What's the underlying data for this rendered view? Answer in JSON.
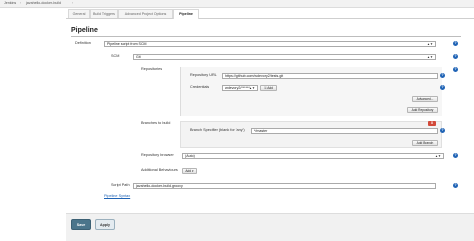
{
  "breadcrumb": {
    "items": [
      "Jenkins",
      "javahello-docker-build"
    ],
    "separator": "›"
  },
  "tabs": [
    {
      "label": "General"
    },
    {
      "label": "Build Triggers"
    },
    {
      "label": "Advanced Project Options"
    },
    {
      "label": "Pipeline"
    }
  ],
  "section": {
    "title": "Pipeline"
  },
  "definition": {
    "label": "Definition",
    "value": "Pipeline script from SCM"
  },
  "scm": {
    "label": "SCM",
    "value": "Git"
  },
  "repositories": {
    "label": "Repositories",
    "url_label": "Repository URL",
    "url_value": "https://github.com/wdevory2/tests.git",
    "credentials_label": "Credentials",
    "credentials_value": "wdevory2/******",
    "add_label": "Add",
    "advanced_label": "Advanced...",
    "add_repository_label": "Add Repository"
  },
  "branches": {
    "label": "Branches to build",
    "specifier_label": "Branch Specifier (blank for 'any')",
    "specifier_value": "*/master",
    "delete_label": "X",
    "add_branch_label": "Add Branch"
  },
  "browser": {
    "label": "Repository browser",
    "value": "(Auto)"
  },
  "behaviours": {
    "label": "Additional Behaviours",
    "add_label": "Add"
  },
  "script_path": {
    "label": "Script Path",
    "value": "javahello-docker-build.groovy"
  },
  "pipeline_syntax": {
    "label": "Pipeline Syntax"
  },
  "footer": {
    "save_label": "Save",
    "apply_label": "Apply"
  },
  "colors": {
    "link": "#1f63b5",
    "save": "#4b758b",
    "delete": "#d24939"
  }
}
